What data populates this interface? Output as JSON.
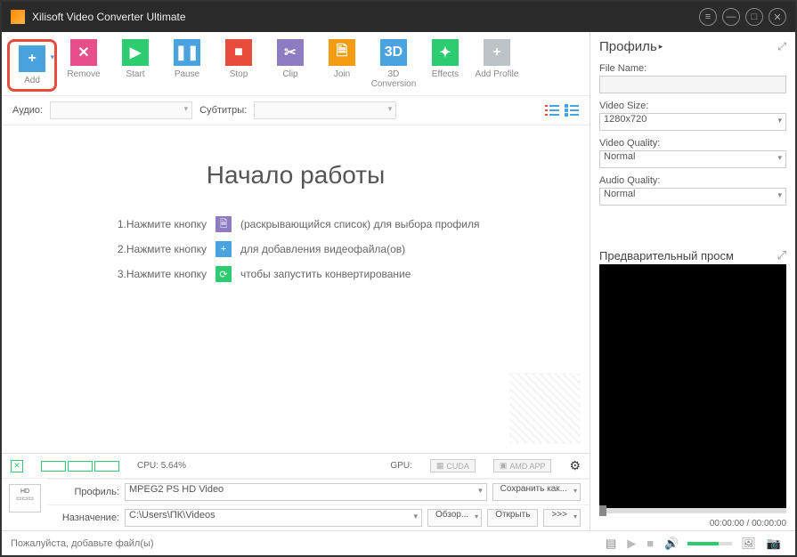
{
  "title": "Xilisoft Video Converter Ultimate",
  "toolbar": [
    {
      "label": "Add",
      "color": "#4aa3df",
      "glyph": "+",
      "highlight": true,
      "dd": true
    },
    {
      "label": "Remove",
      "color": "#e84e8a",
      "glyph": "✕"
    },
    {
      "label": "Start",
      "color": "#2ecc71",
      "glyph": "▶"
    },
    {
      "label": "Pause",
      "color": "#4aa3df",
      "glyph": "❚❚"
    },
    {
      "label": "Stop",
      "color": "#e74c3c",
      "glyph": "■"
    },
    {
      "label": "Clip",
      "color": "#8e7cc3",
      "glyph": "✂"
    },
    {
      "label": "Join",
      "color": "#f39c12",
      "glyph": "🗎"
    },
    {
      "label": "3D Conversion",
      "color": "#4aa3df",
      "glyph": "3D"
    },
    {
      "label": "Effects",
      "color": "#2ecc71",
      "glyph": "✦"
    },
    {
      "label": "Add Profile",
      "color": "#bdc3c7",
      "glyph": "+"
    }
  ],
  "subbar": {
    "audio_label": "Аудио:",
    "subtitle_label": "Субтитры:"
  },
  "main": {
    "heading": "Начало работы",
    "steps": [
      {
        "n": "1.Нажмите кнопку",
        "icon": "#8e7cc3",
        "g": "🗎",
        "t": "(раскрывающийся список) для выбора профиля"
      },
      {
        "n": "2.Нажмите кнопку",
        "icon": "#4aa3df",
        "g": "+",
        "t": "для добавления видеофайла(ов)"
      },
      {
        "n": "3.Нажмите кнопку",
        "icon": "#2ecc71",
        "g": "⟳",
        "t": "чтобы запустить конвертирование"
      }
    ]
  },
  "timeline": {
    "cpu_label": "CPU:",
    "cpu": "5.64%",
    "gpu_label": "GPU:",
    "cuda": "CUDA",
    "amd": "AMD APP"
  },
  "profile": {
    "profile_label": "Профиль:",
    "profile_value": "MPEG2 PS HD Video",
    "save_as": "Сохранить как...",
    "dest_label": "Назначение:",
    "dest_value": "C:\\Users\\ПК\\Videos",
    "browse": "Обзор...",
    "open": "Открыть",
    "dots": ">>>"
  },
  "right": {
    "profile_header": "Профиль",
    "filename_label": "File Name:",
    "videosize_label": "Video Size:",
    "videosize": "1280x720",
    "vquality_label": "Video Quality:",
    "vquality": "Normal",
    "aquality_label": "Audio Quality:",
    "aquality": "Normal",
    "preview_label": "Предварительный просм",
    "time": "00:00:00 / 00:00:00"
  },
  "status": {
    "text": "Пожалуйста, добавьте файл(ы)"
  }
}
